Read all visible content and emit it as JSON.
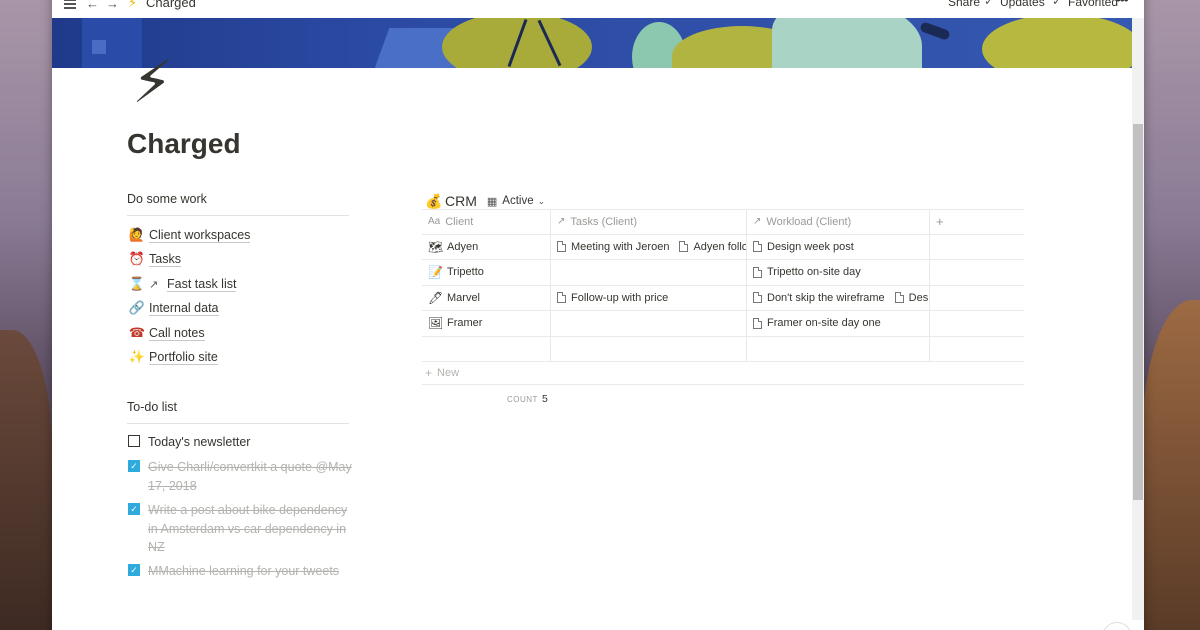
{
  "topbar": {
    "breadcrumb_icon": "⚡",
    "breadcrumb": "Charged",
    "share_label": "Share",
    "updates_label": "Updates",
    "favorited_label": "Favorited",
    "more_label": "•••"
  },
  "page": {
    "icon": "⚡",
    "title": "Charged"
  },
  "work_section": {
    "title": "Do some work",
    "items": [
      {
        "icon": "🙋",
        "label": "Client workspaces",
        "arrow": false
      },
      {
        "icon": "⏰",
        "label": "Tasks",
        "arrow": false
      },
      {
        "icon": "⌛",
        "label": "Fast task list",
        "arrow": true
      },
      {
        "icon": "🔗",
        "label": "Internal data",
        "arrow": false
      },
      {
        "icon": "☎",
        "label": "Call notes",
        "arrow": false
      },
      {
        "icon": "✨",
        "label": "Portfolio site",
        "arrow": false
      }
    ]
  },
  "todo_section": {
    "title": "To-do list",
    "items": [
      {
        "text": "Today's newsletter",
        "checked": false
      },
      {
        "text": "Give Charli/convertkit a quote @May 17, 2018",
        "checked": true
      },
      {
        "text": "Write a post about bike dependency in Amsterdam vs car dependency in NZ",
        "checked": true
      },
      {
        "text": "MMachine learning for your tweets",
        "checked": true
      }
    ]
  },
  "crm": {
    "icon": "💰",
    "title": "CRM",
    "view_label": "Active",
    "columns": [
      {
        "icon": "Aa",
        "label": "Client"
      },
      {
        "icon": "↗",
        "label": "Tasks (Client)"
      },
      {
        "icon": "↗",
        "label": "Workload (Client)"
      },
      {
        "icon": "+",
        "label": ""
      }
    ],
    "rows": [
      {
        "icon": "🗺",
        "client": "Adyen",
        "tasks": [
          "Meeting with Jeroen",
          "Adyen follo"
        ],
        "workload": [
          "Design week post"
        ]
      },
      {
        "icon": "📝",
        "client": "Tripetto",
        "tasks": [],
        "workload": [
          "Tripetto on-site day"
        ]
      },
      {
        "icon": "🖊",
        "client": "Marvel",
        "tasks": [
          "Follow-up with price"
        ],
        "workload": [
          "Don't skip the wireframe",
          "Des"
        ]
      },
      {
        "icon": "🖼",
        "client": "Framer",
        "tasks": [],
        "workload": [
          "Framer on-site day one"
        ]
      }
    ],
    "new_label": "New",
    "count_label": "COUNT",
    "count_value": "5"
  }
}
